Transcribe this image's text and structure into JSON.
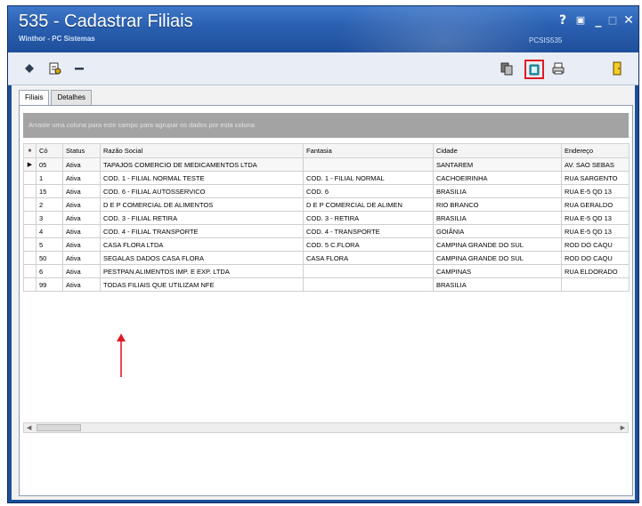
{
  "window": {
    "title": "535 - Cadastrar Filiais",
    "subtitle": "Winthor - PC Sistemas",
    "code": "PCSIS535",
    "controls": [
      "?",
      "▣",
      "_",
      "□",
      "✕"
    ]
  },
  "toolbar": {
    "left_icons": [
      "diamond-icon",
      "report-icon",
      "minus-icon"
    ],
    "right_icons": [
      "copy-icon",
      "clipboard-icon",
      "print-icon",
      "exit-door-icon"
    ],
    "highlighted_icon": "clipboard-icon",
    "highlight_color": "#e01b24"
  },
  "tabs": [
    {
      "label": "Filiais",
      "active": true
    },
    {
      "label": "Detalhes",
      "active": false
    }
  ],
  "grid": {
    "group_hint": "Arraste uma coluna para este campo para agrupar os dados por esta coluna",
    "columns": [
      "Có",
      "Status",
      "Razão Social",
      "Fantasia",
      "Cidade",
      "Endereço"
    ],
    "rows": [
      [
        "05",
        "Ativa",
        "TAPAJOS COMERCIO DE MEDICAMENTOS LTDA",
        "",
        "SANTAREM",
        "AV. SAO SEBAS"
      ],
      [
        "1",
        "Ativa",
        "COD. 1 - FILIAL NORMAL TESTE",
        "COD. 1 - FILIAL NORMAL",
        "CACHOEIRINHA",
        "RUA SARGENTO"
      ],
      [
        "15",
        "Ativa",
        "COD. 6 - FILIAL AUTOSSERVICO",
        "COD. 6",
        "BRASILIA",
        "RUA E-5 QD 13"
      ],
      [
        "2",
        "Ativa",
        "D E P COMERCIAL DE ALIMENTOS",
        "D E P COMERCIAL DE ALIMEN",
        "RIO BRANCO",
        "RUA GERALDO"
      ],
      [
        "3",
        "Ativa",
        "COD. 3 - FILIAL RETIRA",
        "COD. 3 - RETIRA",
        "BRASILIA",
        "RUA E-5 QD 13"
      ],
      [
        "4",
        "Ativa",
        "COD. 4 - FILIAL TRANSPORTE",
        "COD. 4 - TRANSPORTE",
        "GOIÂNIA",
        "RUA E-5 QD 13"
      ],
      [
        "5",
        "Ativa",
        "CASA FLORA LTDA",
        "COD. 5 C.FLORA",
        "CAMPINA GRANDE DO SUL",
        "ROD DO CAQU"
      ],
      [
        "50",
        "Ativa",
        "SEGALAS DADOS CASA FLORA",
        "CASA FLORA",
        "CAMPINA GRANDE DO SUL",
        "ROD DO CAQU"
      ],
      [
        "6",
        "Ativa",
        "PESTPAN ALIMENTOS IMP. E EXP. LTDA",
        "",
        "CAMPINAS",
        "RUA ELDORADO"
      ],
      [
        "99",
        "Ativa",
        "TODAS FILIAIS QUE UTILIZAM NFE",
        "",
        "BRASILIA",
        ""
      ]
    ],
    "selected_row": 0
  },
  "annotation": {
    "arrow_color": "#e01b24"
  }
}
